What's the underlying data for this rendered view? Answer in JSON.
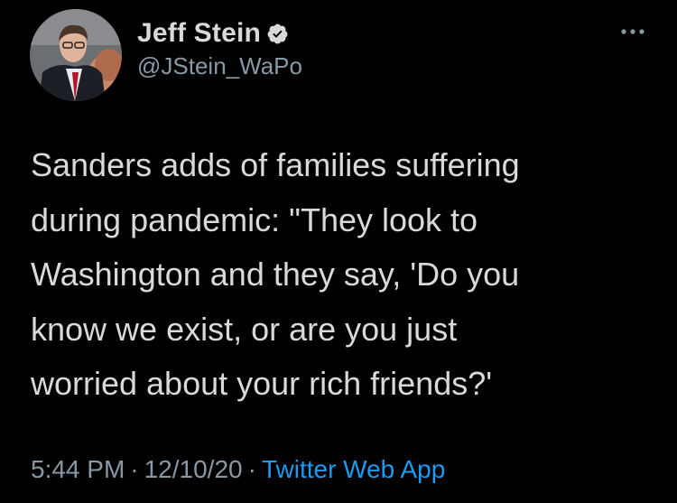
{
  "author": {
    "display_name": "Jeff Stein",
    "handle": "@JStein_WaPo",
    "verified": true
  },
  "tweet": {
    "text_lines": [
      "Sanders adds of families suffering",
      "during pandemic: \"They look to",
      "Washington and they say, 'Do you",
      "know we exist, or are you just",
      "worried about your rich friends?'"
    ]
  },
  "meta": {
    "time": "5:44 PM",
    "separator": "·",
    "date": "12/10/20",
    "source": "Twitter Web App"
  },
  "colors": {
    "background": "#000000",
    "primary_text": "#d9d9d9",
    "secondary_text": "#8899a6",
    "accent": "#1d9bf0"
  },
  "icons": {
    "verified": "verified-badge-icon",
    "more": "more-options-icon"
  }
}
